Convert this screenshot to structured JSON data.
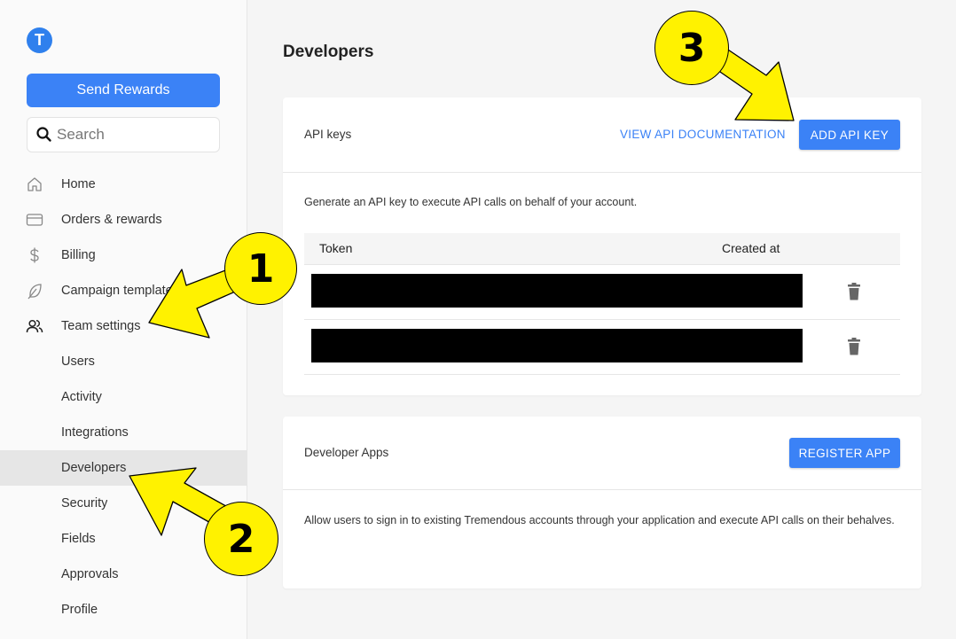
{
  "app": {
    "logo_letter": "T"
  },
  "sidebar": {
    "send_rewards_label": "Send Rewards",
    "search_placeholder": "Search",
    "items": [
      {
        "label": "Home",
        "icon": "home-icon"
      },
      {
        "label": "Orders & rewards",
        "icon": "card-icon"
      },
      {
        "label": "Billing",
        "icon": "dollar-icon"
      },
      {
        "label": "Campaign templates",
        "icon": "feather-icon"
      },
      {
        "label": "Team settings",
        "icon": "users-icon"
      },
      {
        "label": "Users"
      },
      {
        "label": "Activity"
      },
      {
        "label": "Integrations"
      },
      {
        "label": "Developers",
        "active": true
      },
      {
        "label": "Security"
      },
      {
        "label": "Fields"
      },
      {
        "label": "Approvals"
      },
      {
        "label": "Profile"
      }
    ]
  },
  "main": {
    "title": "Developers",
    "api_keys": {
      "title": "API keys",
      "docs_link": "VIEW API DOCUMENTATION",
      "add_button": "ADD API KEY",
      "description": "Generate an API key to execute API calls on behalf of your account.",
      "columns": [
        "Token",
        "Created at"
      ],
      "rows": [
        {
          "token": ""
        },
        {
          "token": ""
        }
      ]
    },
    "developer_apps": {
      "title": "Developer Apps",
      "register_button": "REGISTER APP",
      "description": "Allow users to sign in to existing Tremendous accounts through your application and execute API calls on their behalves."
    }
  },
  "annotations": {
    "badge_1": "1",
    "badge_2": "2",
    "badge_3": "3"
  },
  "colors": {
    "accent": "#3b82f6",
    "annotation": "#fff200"
  }
}
